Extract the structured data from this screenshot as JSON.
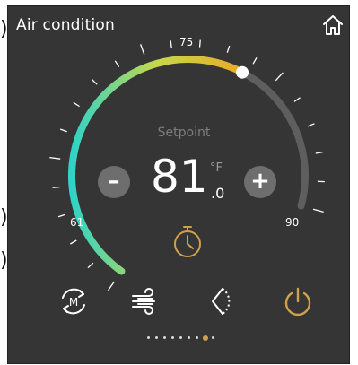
{
  "header": {
    "title": "Air condition",
    "home_icon": "home-icon"
  },
  "thermostat": {
    "setpoint_label": "Setpoint",
    "temperature": "81",
    "decimal": ".0",
    "unit": "°F",
    "minus_label": "–",
    "plus_label": "+",
    "scale_min": "61",
    "scale_max": "90",
    "scale_mid": "75",
    "level_fraction": 0.69
  },
  "controls": {
    "timer_icon": "timer-icon",
    "mode_icon": "mode-cycle-icon",
    "mode_letter": "M",
    "fan_icon": "fan-wind-icon",
    "swing_icon": "swing-icon",
    "power_icon": "power-icon"
  },
  "pager": {
    "count": 9,
    "active_index": 7
  },
  "colors": {
    "panel": "#353535",
    "accent": "#d0a04c",
    "arc_start": "#2ed4c8",
    "arc_mid": "#c6d84a",
    "arc_end": "#f0a020",
    "arc_inactive": "#5e5e5e"
  }
}
